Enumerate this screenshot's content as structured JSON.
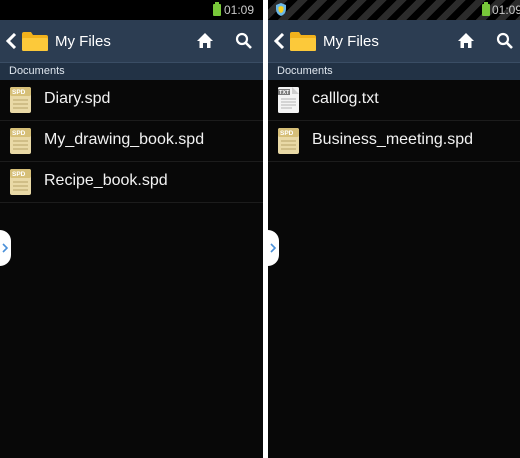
{
  "colors": {
    "actionbar": "#2c3d52",
    "section_header": "#223245",
    "battery": "#79c83a",
    "background": "#080808"
  },
  "left": {
    "status": {
      "time": "01:09"
    },
    "actionbar": {
      "title": "My Files",
      "icons": [
        "back-chevron-icon",
        "folder-icon",
        "home-icon",
        "search-icon"
      ]
    },
    "section": "Documents",
    "files": [
      {
        "name": "Diary.spd",
        "icon_label": "SPD"
      },
      {
        "name": "My_drawing_book.spd",
        "icon_label": "SPD"
      },
      {
        "name": "Recipe_book.spd",
        "icon_label": "SPD"
      }
    ]
  },
  "right": {
    "status": {
      "time": "01:09"
    },
    "actionbar": {
      "title": "My Files",
      "icons": [
        "back-chevron-icon",
        "folder-icon",
        "home-icon",
        "search-icon"
      ]
    },
    "section": "Documents",
    "files": [
      {
        "name": "calllog.txt",
        "icon_label": "TXT"
      },
      {
        "name": "Business_meeting.spd",
        "icon_label": "SPD"
      }
    ]
  }
}
